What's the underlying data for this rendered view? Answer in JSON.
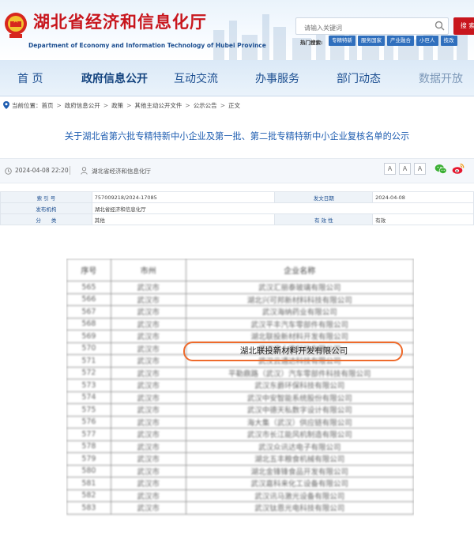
{
  "header": {
    "site_title": "湖北省经济和信息化厅",
    "site_subtitle": "Department of Economy and Information Technology of Hubei Province",
    "search_placeholder": "请输入关键词",
    "search_button": "搜 索",
    "quick_label": "热门搜索:",
    "quick_links": [
      "专精特新",
      "服务国家",
      "产业融合",
      "小巨人",
      "技改"
    ],
    "brand_color": "#c8161d"
  },
  "nav": {
    "items": [
      "首 页",
      "政府信息公开",
      "互动交流",
      "办事服务",
      "部门动态",
      "数据开放"
    ]
  },
  "breadcrumb": {
    "label": "当前位置：",
    "items": [
      "首页",
      "政府信息公开",
      "政策",
      "其他主动公开文件",
      "公示公告",
      "正文"
    ]
  },
  "article": {
    "title": "关于湖北省第六批专精特新中小企业及第一批、第二批专精特新中小企业复核名单的公示",
    "date": "2024-04-08 22:20",
    "source": "湖北省经济和信息化厅",
    "font_buttons": [
      "A",
      "A",
      "A"
    ],
    "share_icons": [
      "wechat-icon",
      "weibo-icon"
    ]
  },
  "info_table": {
    "index_label": "索 引 号",
    "index_value": "757009218/2024-17085",
    "date_label": "发文日期",
    "date_value": "2024-04-08",
    "org_label": "发布机构",
    "org_value": "湖北省经济和信息化厅",
    "category_label": "分　　类",
    "category_value": "其他",
    "validity_label": "有 效 性",
    "validity_value": "有效"
  },
  "doc_table": {
    "headers": [
      "序号",
      "市州",
      "企业名称"
    ],
    "rows": [
      [
        "565",
        "武汉市",
        "武汉汇丽泰玻璃有限公司"
      ],
      [
        "566",
        "武汉市",
        "湖北兴可邦新材料科技有限公司"
      ],
      [
        "567",
        "武汉市",
        "武汉海纳药业有限公司"
      ],
      [
        "568",
        "武汉市",
        "武汉平丰汽车零部件有限公司"
      ],
      [
        "569",
        "武汉市",
        "湖北联投新材料开发有限公司"
      ],
      [
        "570",
        "武汉市",
        "武汉唐土康科技有限公司"
      ],
      [
        "571",
        "武汉市",
        "武汉云通达科技有限公司"
      ],
      [
        "572",
        "武汉市",
        "平勒鼎路（武汉）汽车零部件科技有限公司"
      ],
      [
        "573",
        "武汉市",
        "武汉东爵环保科技有限公司"
      ],
      [
        "574",
        "武汉市",
        "武汉中安智能系统股份有限公司"
      ],
      [
        "575",
        "武汉市",
        "武汉中德天私数字设计有限公司"
      ],
      [
        "576",
        "武汉市",
        "海大集（武汉）供应链有限公司"
      ],
      [
        "577",
        "武汉市",
        "武汉市长江能风机制造有限公司"
      ],
      [
        "578",
        "武汉市",
        "武汉众讯达电子有限公司"
      ],
      [
        "579",
        "武汉市",
        "湖北五丰粮食机械有限公司"
      ],
      [
        "580",
        "武汉市",
        "湖北金锋锋食品开发有限公司"
      ],
      [
        "581",
        "武汉市",
        "武汉嘉科来化工设备有限公司"
      ],
      [
        "582",
        "武汉市",
        "武汉讯马激光设备有限公司"
      ],
      [
        "583",
        "武汉市",
        "武汉钛恩光电科技有限公司"
      ]
    ],
    "highlighted_company": "湖北联投新材料开发有限公司",
    "highlight_color": "#ee6a2b"
  }
}
